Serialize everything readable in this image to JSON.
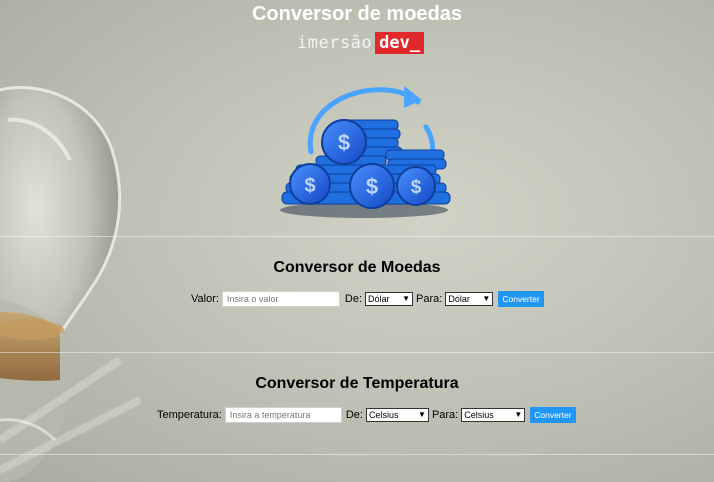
{
  "header": {
    "title": "Conversor de moedas",
    "logo_text": "imersão",
    "logo_badge": "dev_"
  },
  "currency": {
    "title": "Conversor de Moedas",
    "value_label": "Valor:",
    "value_placeholder": "Insira o valor",
    "from_label": "De:",
    "from_selected": "Dólar",
    "to_label": "Para:",
    "to_selected": "Dólar",
    "button": "Converter"
  },
  "temperature": {
    "title": "Conversor de Temperatura",
    "value_label": "Temperatura:",
    "value_placeholder": "Insira a temperatura",
    "from_label": "De:",
    "from_selected": "Celsius",
    "to_label": "Para:",
    "to_selected": "Celsius",
    "button": "Converter"
  },
  "colors": {
    "accent": "#2196f3",
    "logo_red": "#e1292b",
    "coin_blue": "#1f6fe0"
  },
  "icons": {
    "hero": "coin-stack-icon",
    "select": "chevron-down-icon"
  }
}
